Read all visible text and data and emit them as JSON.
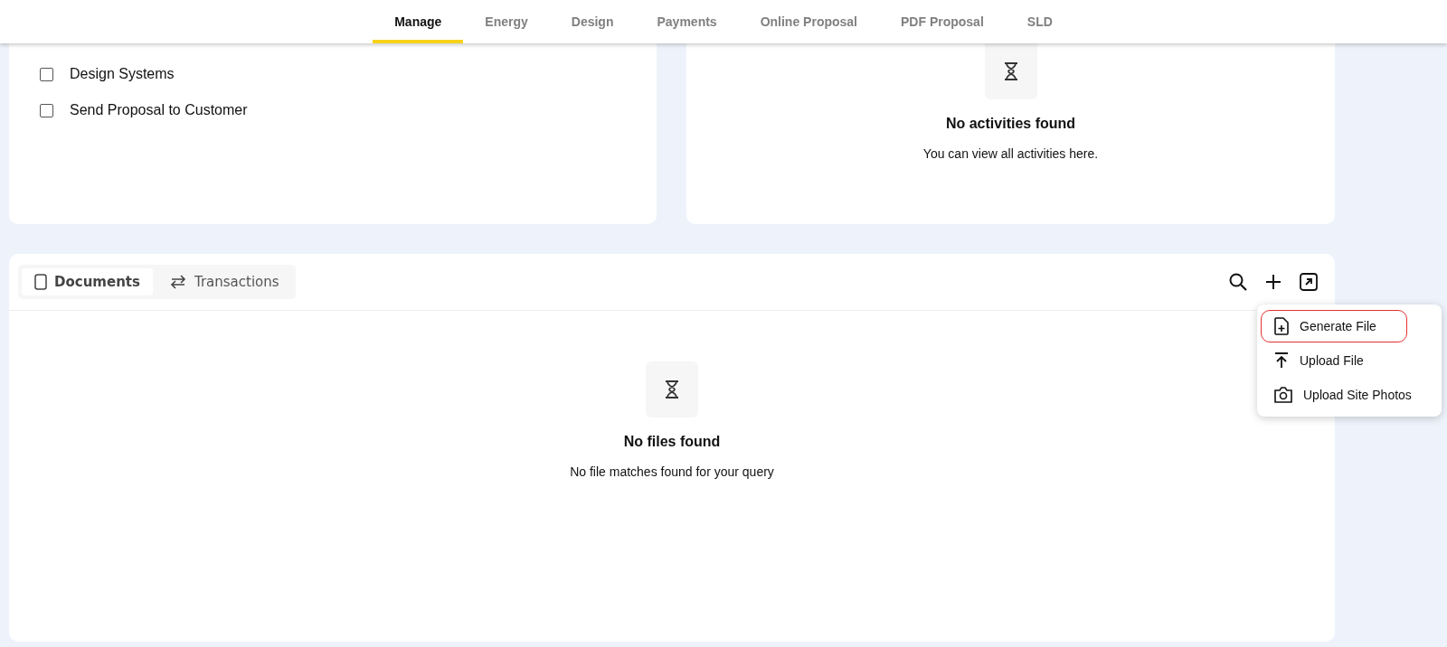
{
  "nav_tabs": [
    {
      "label": "Manage",
      "selected": true
    },
    {
      "label": "Energy",
      "selected": false
    },
    {
      "label": "Design",
      "selected": false
    },
    {
      "label": "Payments",
      "selected": false
    },
    {
      "label": "Online Proposal",
      "selected": false
    },
    {
      "label": "PDF Proposal",
      "selected": false
    },
    {
      "label": "SLD",
      "selected": false
    }
  ],
  "tasks": [
    {
      "label": "Design Systems",
      "checked": false
    },
    {
      "label": "Send Proposal to Customer",
      "checked": false
    }
  ],
  "activities": {
    "title": "No activities found",
    "message": "You can view all activities here."
  },
  "documents": {
    "tabs": [
      {
        "label": "Documents",
        "kind": "documents",
        "selected": true
      },
      {
        "label": "Transactions",
        "kind": "transactions",
        "selected": false
      }
    ],
    "empty": {
      "title": "No files found",
      "message": "No file matches found for your query"
    },
    "menu": [
      {
        "label": "Generate File",
        "kind": "generate",
        "highlighted": true
      },
      {
        "label": "Upload File",
        "kind": "upload",
        "highlighted": false
      },
      {
        "label": "Upload Site Photos",
        "kind": "photos",
        "highlighted": false
      }
    ]
  }
}
